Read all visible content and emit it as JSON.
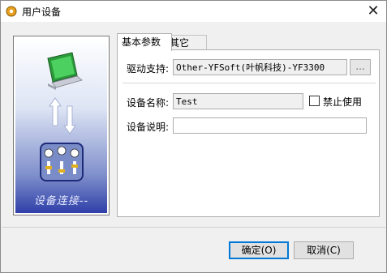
{
  "window": {
    "title": "用户设备",
    "close_glyph": "✕"
  },
  "sidebar": {
    "caption": "设备连接--"
  },
  "tabs": [
    {
      "label": "基本参数"
    },
    {
      "label": "其它"
    }
  ],
  "form": {
    "driver_label": "驱动支持:",
    "driver_value": "Other-YFSoft(叶帆科技)-YF3300",
    "browse_label": "...",
    "name_label": "设备名称:",
    "name_value": "Test",
    "disable_label": "禁止使用",
    "disable_checked": false,
    "desc_label": "设备说明:",
    "desc_value": ""
  },
  "buttons": {
    "ok": "确定(O)",
    "cancel": "取消(C)"
  }
}
